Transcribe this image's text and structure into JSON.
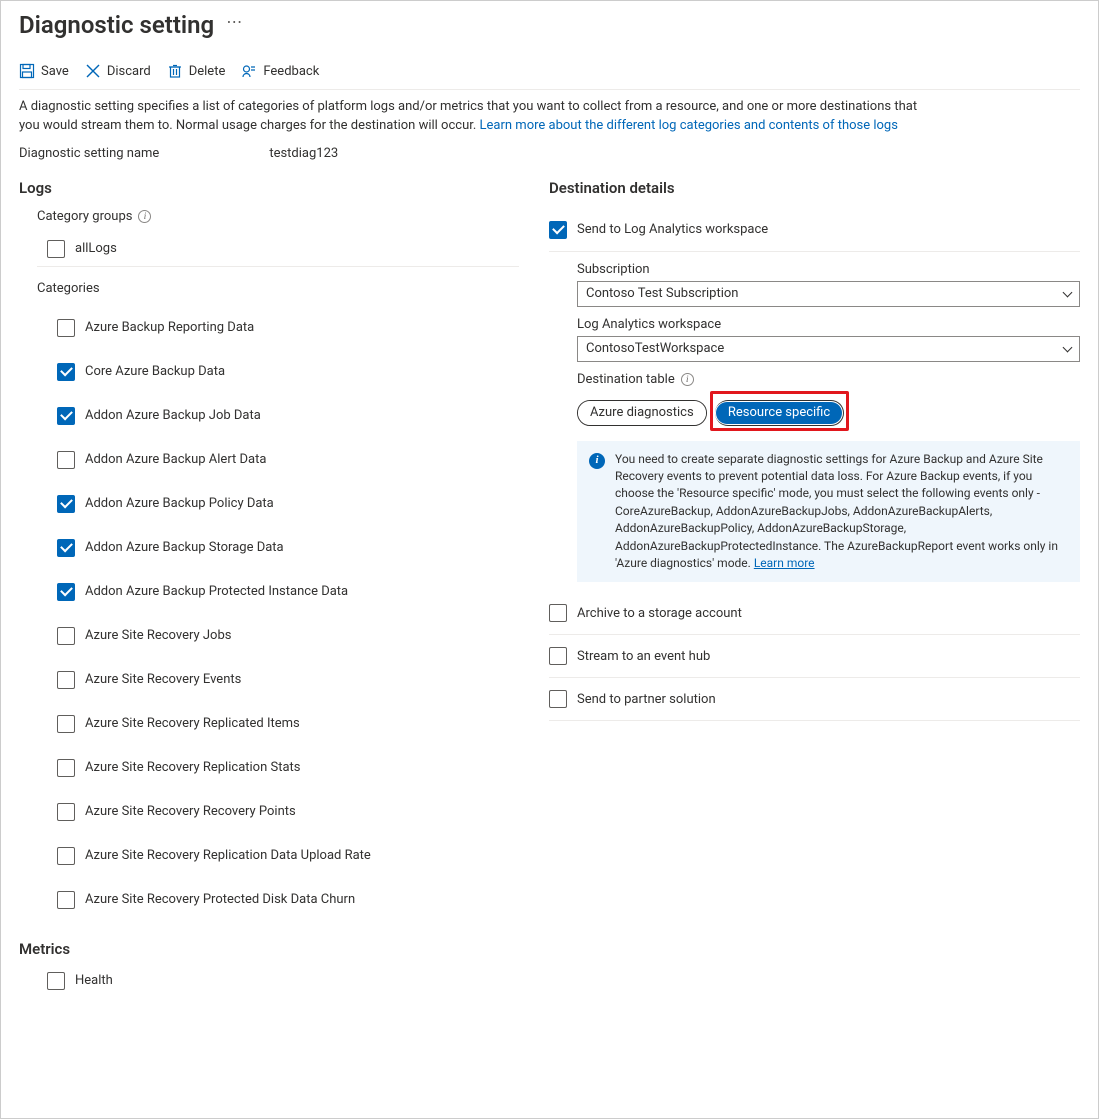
{
  "header": {
    "title": "Diagnostic setting",
    "more": "⋯"
  },
  "toolbar": {
    "save": "Save",
    "discard": "Discard",
    "delete": "Delete",
    "feedback": "Feedback"
  },
  "description": {
    "text": "A diagnostic setting specifies a list of categories of platform logs and/or metrics that you want to collect from a resource, and one or more destinations that you would stream them to. Normal usage charges for the destination will occur. ",
    "link": "Learn more about the different log categories and contents of those logs"
  },
  "setting_name": {
    "label": "Diagnostic setting name",
    "value": "testdiag123"
  },
  "logs": {
    "heading": "Logs",
    "category_groups_label": "Category groups",
    "allLogs_label": "allLogs",
    "categories_label": "Categories",
    "items": [
      {
        "label": "Azure Backup Reporting Data",
        "checked": false
      },
      {
        "label": "Core Azure Backup Data",
        "checked": true
      },
      {
        "label": "Addon Azure Backup Job Data",
        "checked": true
      },
      {
        "label": "Addon Azure Backup Alert Data",
        "checked": false
      },
      {
        "label": "Addon Azure Backup Policy Data",
        "checked": true
      },
      {
        "label": "Addon Azure Backup Storage Data",
        "checked": true
      },
      {
        "label": "Addon Azure Backup Protected Instance Data",
        "checked": true
      },
      {
        "label": "Azure Site Recovery Jobs",
        "checked": false
      },
      {
        "label": "Azure Site Recovery Events",
        "checked": false
      },
      {
        "label": "Azure Site Recovery Replicated Items",
        "checked": false
      },
      {
        "label": "Azure Site Recovery Replication Stats",
        "checked": false
      },
      {
        "label": "Azure Site Recovery Recovery Points",
        "checked": false
      },
      {
        "label": "Azure Site Recovery Replication Data Upload Rate",
        "checked": false
      },
      {
        "label": "Azure Site Recovery Protected Disk Data Churn",
        "checked": false
      }
    ]
  },
  "metrics": {
    "heading": "Metrics",
    "items": [
      {
        "label": "Health",
        "checked": false
      }
    ]
  },
  "dest": {
    "heading": "Destination details",
    "send_la": {
      "label": "Send to Log Analytics workspace",
      "checked": true
    },
    "subscription": {
      "label": "Subscription",
      "value": "Contoso Test Subscription"
    },
    "workspace": {
      "label": "Log Analytics workspace",
      "value": "ContosoTestWorkspace"
    },
    "dest_table": {
      "label": "Destination table",
      "option1": "Azure diagnostics",
      "option2": "Resource specific"
    },
    "info": {
      "text": "You need to create separate diagnostic settings for Azure Backup and Azure Site Recovery events to prevent potential data loss. For Azure Backup events, if you choose the 'Resource specific' mode, you must select the following events only - CoreAzureBackup, AddonAzureBackupJobs, AddonAzureBackupAlerts, AddonAzureBackupPolicy, AddonAzureBackupStorage, AddonAzureBackupProtectedInstance. The AzureBackupReport event works only in 'Azure diagnostics' mode.  ",
      "link": "Learn more"
    },
    "archive": {
      "label": "Archive to a storage account",
      "checked": false
    },
    "eventhub": {
      "label": "Stream to an event hub",
      "checked": false
    },
    "partner": {
      "label": "Send to partner solution",
      "checked": false
    }
  }
}
